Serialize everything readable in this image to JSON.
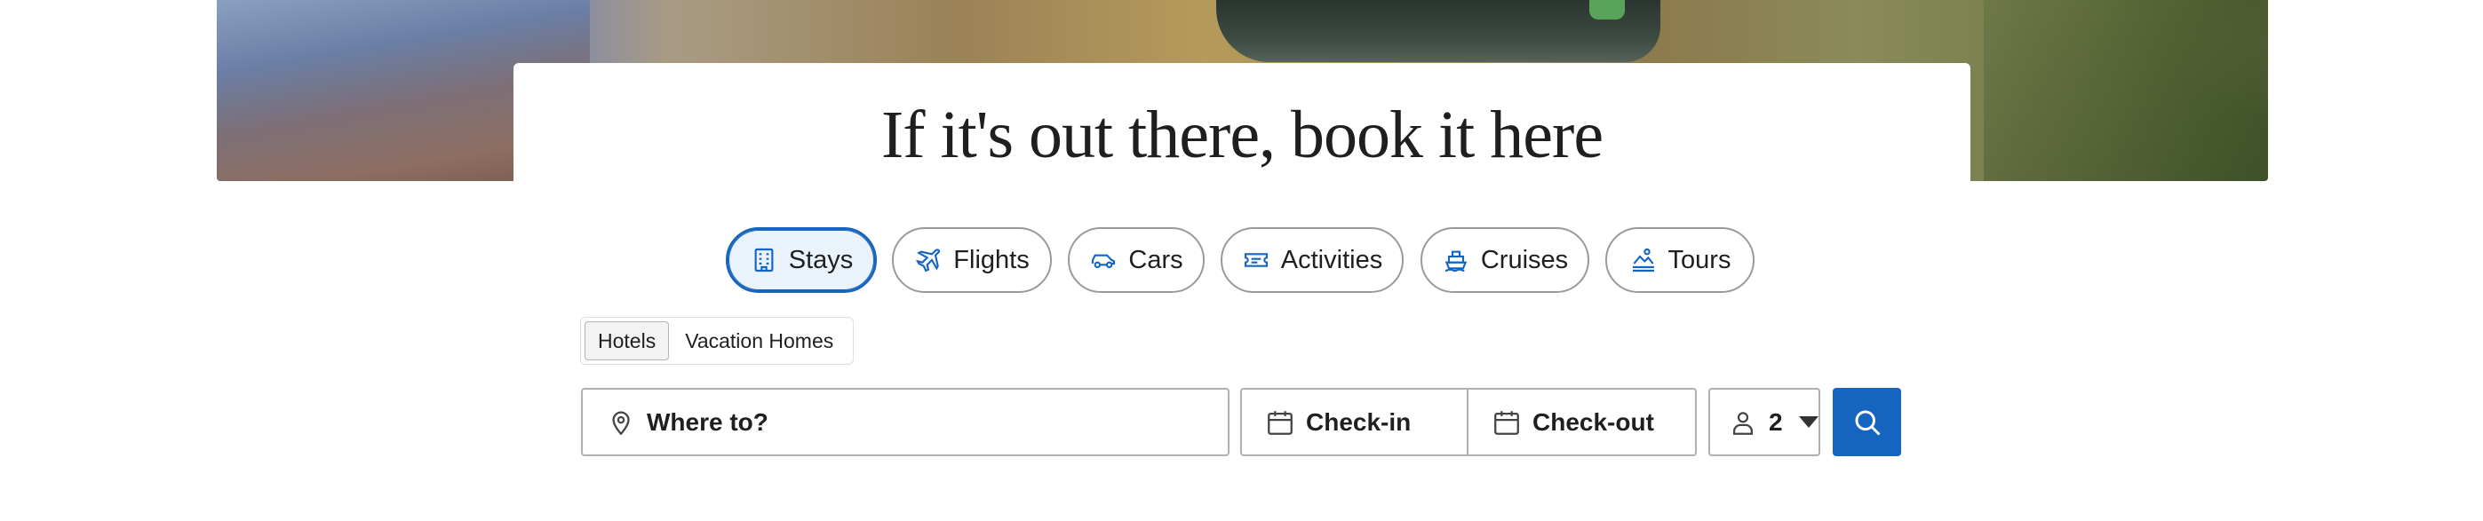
{
  "hero": {
    "headline": "If it's out there, book it here"
  },
  "categories": [
    {
      "label": "Stays",
      "icon": "hotel-icon",
      "active": true
    },
    {
      "label": "Flights",
      "icon": "plane-icon",
      "active": false
    },
    {
      "label": "Cars",
      "icon": "car-icon",
      "active": false
    },
    {
      "label": "Activities",
      "icon": "ticket-icon",
      "active": false
    },
    {
      "label": "Cruises",
      "icon": "ship-icon",
      "active": false
    },
    {
      "label": "Tours",
      "icon": "tour-icon",
      "active": false
    }
  ],
  "subtabs": [
    {
      "label": "Hotels",
      "active": true
    },
    {
      "label": "Vacation Homes",
      "active": false
    }
  ],
  "search": {
    "destination_placeholder": "Where to?",
    "checkin_label": "Check-in",
    "checkout_label": "Check-out",
    "guests_value": "2"
  },
  "colors": {
    "accent": "#1565c0",
    "text": "#1f1f1f",
    "border": "#b0b0b0"
  }
}
